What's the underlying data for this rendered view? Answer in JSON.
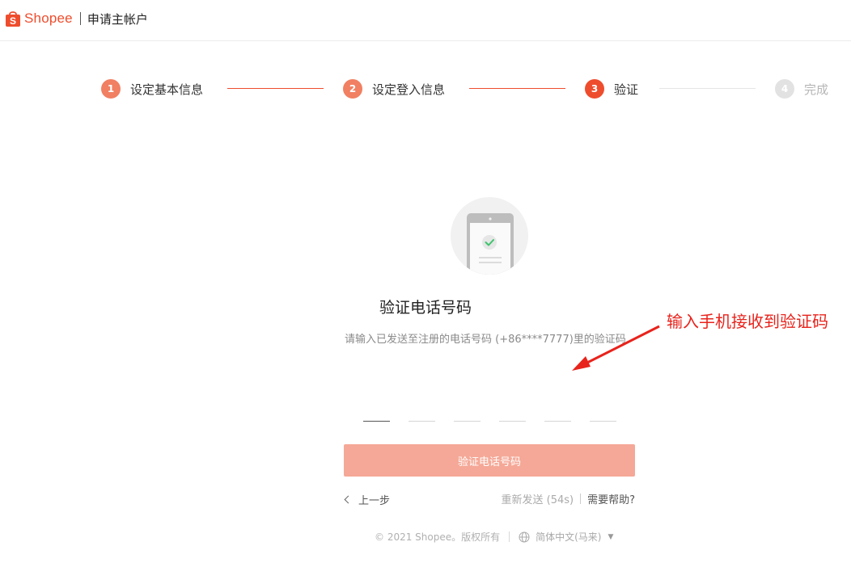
{
  "header": {
    "brand": "Shopee",
    "title": "申请主帐户",
    "accent_color": "#ee4d2d"
  },
  "stepper": {
    "steps": [
      {
        "number": "1",
        "label": "设定基本信息",
        "state": "done"
      },
      {
        "number": "2",
        "label": "设定登入信息",
        "state": "done"
      },
      {
        "number": "3",
        "label": "验证",
        "state": "active"
      },
      {
        "number": "4",
        "label": "完成",
        "state": "todo"
      }
    ]
  },
  "verify": {
    "illustration_icon": "phone-check-icon",
    "title": "验证电话号码",
    "subtitle": "请输入已发送至注册的电话号码 (+86****7777)里的验证码",
    "code_slots": 6,
    "button_label": "验证电话号码",
    "back_label": "上一步",
    "resend_label": "重新发送 (54s)",
    "help_label": "需要帮助?"
  },
  "footer": {
    "copyright": "© 2021 Shopee。版权所有",
    "language": "简体中文(马来)"
  },
  "annotation": {
    "text": "输入手机接收到验证码",
    "color": "#e8231c"
  }
}
